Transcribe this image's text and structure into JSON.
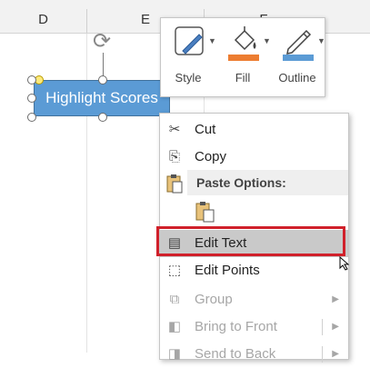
{
  "sheet": {
    "columns": [
      "D",
      "E",
      "F"
    ]
  },
  "shape": {
    "text": "Highlight Scores",
    "fill": "#5b9bd5"
  },
  "mini_toolbar": {
    "style_label": "Style",
    "fill_label": "Fill",
    "outline_label": "Outline",
    "fill_color": "#ed7d31",
    "outline_color": "#5b9bd5"
  },
  "context_menu": {
    "cut": "Cut",
    "copy": "Copy",
    "paste_options": "Paste Options:",
    "edit_text": "Edit Text",
    "edit_points": "Edit Points",
    "group": "Group",
    "bring_to_front": "Bring to Front",
    "send_to_back": "Send to Back",
    "highlight_color": "#d0202a"
  }
}
